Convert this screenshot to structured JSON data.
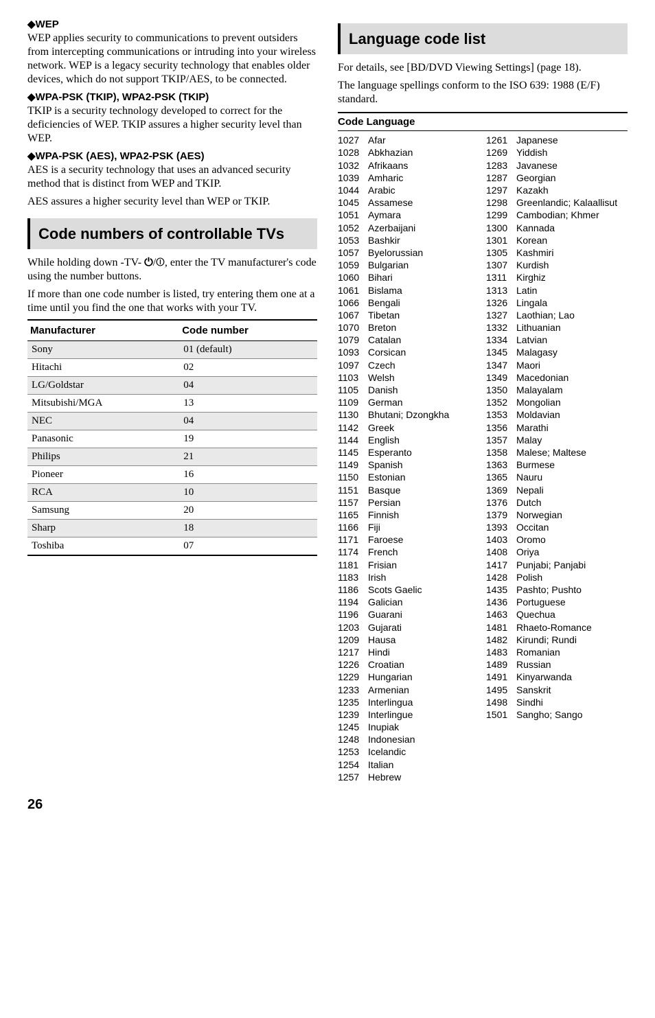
{
  "left": {
    "wep": {
      "head": "◆WEP",
      "para": "WEP applies security to communications to prevent outsiders from intercepting communications or intruding into your wireless network. WEP is a legacy security technology that enables older devices, which do not support TKIP/AES, to be connected."
    },
    "tkip": {
      "head": "◆WPA-PSK (TKIP), WPA2-PSK (TKIP)",
      "para": "TKIP is a security technology developed to correct for the deficiencies of WEP. TKIP assures a higher security level than WEP."
    },
    "aes": {
      "head": "◆WPA-PSK (AES), WPA2-PSK (AES)",
      "para1": "AES is a security technology that uses an advanced security method that is distinct from WEP and TKIP.",
      "para2": "AES assures a higher security level than WEP or TKIP."
    },
    "controllable": {
      "title": "Code numbers of controllable TVs",
      "intro1_a": "While holding down -TV- ",
      "intro1_b": ", enter the TV manufacturer's code using the number buttons.",
      "intro2": "If more than one code number is listed, try entering them one at a time until you find the one that works with your TV.",
      "th_manu": "Manufacturer",
      "th_code": "Code number",
      "rows": [
        {
          "m": "Sony",
          "c": "01 (default)"
        },
        {
          "m": "Hitachi",
          "c": "02"
        },
        {
          "m": "LG/Goldstar",
          "c": "04"
        },
        {
          "m": "Mitsubishi/MGA",
          "c": "13"
        },
        {
          "m": "NEC",
          "c": "04"
        },
        {
          "m": "Panasonic",
          "c": "19"
        },
        {
          "m": "Philips",
          "c": "21"
        },
        {
          "m": "Pioneer",
          "c": "16"
        },
        {
          "m": "RCA",
          "c": "10"
        },
        {
          "m": "Samsung",
          "c": "20"
        },
        {
          "m": "Sharp",
          "c": "18"
        },
        {
          "m": "Toshiba",
          "c": "07"
        }
      ]
    }
  },
  "right": {
    "lang": {
      "title": "Language code list",
      "intro1": "For details, see [BD/DVD Viewing Settings] (page 18).",
      "intro2": "The language spellings conform to the ISO 639: 1988 (E/F) standard.",
      "head": "Code Language",
      "col1": [
        {
          "c": "1027",
          "n": "Afar"
        },
        {
          "c": "1028",
          "n": "Abkhazian"
        },
        {
          "c": "1032",
          "n": "Afrikaans"
        },
        {
          "c": "1039",
          "n": "Amharic"
        },
        {
          "c": "1044",
          "n": "Arabic"
        },
        {
          "c": "1045",
          "n": "Assamese"
        },
        {
          "c": "1051",
          "n": "Aymara"
        },
        {
          "c": "1052",
          "n": "Azerbaijani"
        },
        {
          "c": "1053",
          "n": "Bashkir"
        },
        {
          "c": "1057",
          "n": "Byelorussian"
        },
        {
          "c": "1059",
          "n": "Bulgarian"
        },
        {
          "c": "1060",
          "n": "Bihari"
        },
        {
          "c": "1061",
          "n": "Bislama"
        },
        {
          "c": "1066",
          "n": "Bengali"
        },
        {
          "c": "1067",
          "n": "Tibetan"
        },
        {
          "c": "1070",
          "n": "Breton"
        },
        {
          "c": "1079",
          "n": "Catalan"
        },
        {
          "c": "1093",
          "n": "Corsican"
        },
        {
          "c": "1097",
          "n": "Czech"
        },
        {
          "c": "1103",
          "n": "Welsh"
        },
        {
          "c": "1105",
          "n": "Danish"
        },
        {
          "c": "1109",
          "n": "German"
        },
        {
          "c": "1130",
          "n": "Bhutani; Dzongkha"
        },
        {
          "c": "1142",
          "n": "Greek"
        },
        {
          "c": "1144",
          "n": "English"
        },
        {
          "c": "1145",
          "n": "Esperanto"
        },
        {
          "c": "1149",
          "n": "Spanish"
        },
        {
          "c": "1150",
          "n": "Estonian"
        },
        {
          "c": "1151",
          "n": "Basque"
        },
        {
          "c": "1157",
          "n": "Persian"
        },
        {
          "c": "1165",
          "n": "Finnish"
        },
        {
          "c": "1166",
          "n": "Fiji"
        },
        {
          "c": "1171",
          "n": "Faroese"
        },
        {
          "c": "1174",
          "n": "French"
        },
        {
          "c": "1181",
          "n": "Frisian"
        },
        {
          "c": "1183",
          "n": "Irish"
        },
        {
          "c": "1186",
          "n": "Scots Gaelic"
        },
        {
          "c": "1194",
          "n": "Galician"
        },
        {
          "c": "1196",
          "n": "Guarani"
        },
        {
          "c": "1203",
          "n": "Gujarati"
        },
        {
          "c": "1209",
          "n": "Hausa"
        },
        {
          "c": "1217",
          "n": "Hindi"
        },
        {
          "c": "1226",
          "n": "Croatian"
        },
        {
          "c": "1229",
          "n": "Hungarian"
        },
        {
          "c": "1233",
          "n": "Armenian"
        },
        {
          "c": "1235",
          "n": "Interlingua"
        },
        {
          "c": "1239",
          "n": "Interlingue"
        },
        {
          "c": "1245",
          "n": "Inupiak"
        },
        {
          "c": "1248",
          "n": "Indonesian"
        },
        {
          "c": "1253",
          "n": "Icelandic"
        },
        {
          "c": "1254",
          "n": "Italian"
        },
        {
          "c": "1257",
          "n": "Hebrew"
        }
      ],
      "col2": [
        {
          "c": "1261",
          "n": "Japanese"
        },
        {
          "c": "1269",
          "n": "Yiddish"
        },
        {
          "c": "1283",
          "n": "Javanese"
        },
        {
          "c": "1287",
          "n": "Georgian"
        },
        {
          "c": "1297",
          "n": "Kazakh"
        },
        {
          "c": "1298",
          "n": "Greenlandic; Kalaallisut"
        },
        {
          "c": "1299",
          "n": "Cambodian; Khmer"
        },
        {
          "c": "1300",
          "n": "Kannada"
        },
        {
          "c": "1301",
          "n": "Korean"
        },
        {
          "c": "1305",
          "n": "Kashmiri"
        },
        {
          "c": "1307",
          "n": "Kurdish"
        },
        {
          "c": "1311",
          "n": "Kirghiz"
        },
        {
          "c": "1313",
          "n": "Latin"
        },
        {
          "c": "1326",
          "n": "Lingala"
        },
        {
          "c": "1327",
          "n": "Laothian; Lao"
        },
        {
          "c": "1332",
          "n": "Lithuanian"
        },
        {
          "c": "1334",
          "n": "Latvian"
        },
        {
          "c": "1345",
          "n": "Malagasy"
        },
        {
          "c": "1347",
          "n": "Maori"
        },
        {
          "c": "1349",
          "n": "Macedonian"
        },
        {
          "c": "1350",
          "n": "Malayalam"
        },
        {
          "c": "1352",
          "n": "Mongolian"
        },
        {
          "c": "1353",
          "n": "Moldavian"
        },
        {
          "c": "1356",
          "n": "Marathi"
        },
        {
          "c": "1357",
          "n": "Malay"
        },
        {
          "c": "1358",
          "n": "Malese; Maltese"
        },
        {
          "c": "1363",
          "n": "Burmese"
        },
        {
          "c": "1365",
          "n": "Nauru"
        },
        {
          "c": "1369",
          "n": "Nepali"
        },
        {
          "c": "1376",
          "n": "Dutch"
        },
        {
          "c": "1379",
          "n": "Norwegian"
        },
        {
          "c": "1393",
          "n": "Occitan"
        },
        {
          "c": "1403",
          "n": "Oromo"
        },
        {
          "c": "1408",
          "n": "Oriya"
        },
        {
          "c": "1417",
          "n": "Punjabi; Panjabi"
        },
        {
          "c": "1428",
          "n": "Polish"
        },
        {
          "c": "1435",
          "n": "Pashto; Pushto"
        },
        {
          "c": "1436",
          "n": "Portuguese"
        },
        {
          "c": "1463",
          "n": "Quechua"
        },
        {
          "c": "1481",
          "n": "Rhaeto-Romance"
        },
        {
          "c": "1482",
          "n": "Kirundi; Rundi"
        },
        {
          "c": "1483",
          "n": "Romanian"
        },
        {
          "c": "1489",
          "n": "Russian"
        },
        {
          "c": "1491",
          "n": "Kinyarwanda"
        },
        {
          "c": "1495",
          "n": "Sanskrit"
        },
        {
          "c": "1498",
          "n": "Sindhi"
        },
        {
          "c": "1501",
          "n": "Sangho; Sango"
        }
      ]
    }
  },
  "page_number": "26"
}
